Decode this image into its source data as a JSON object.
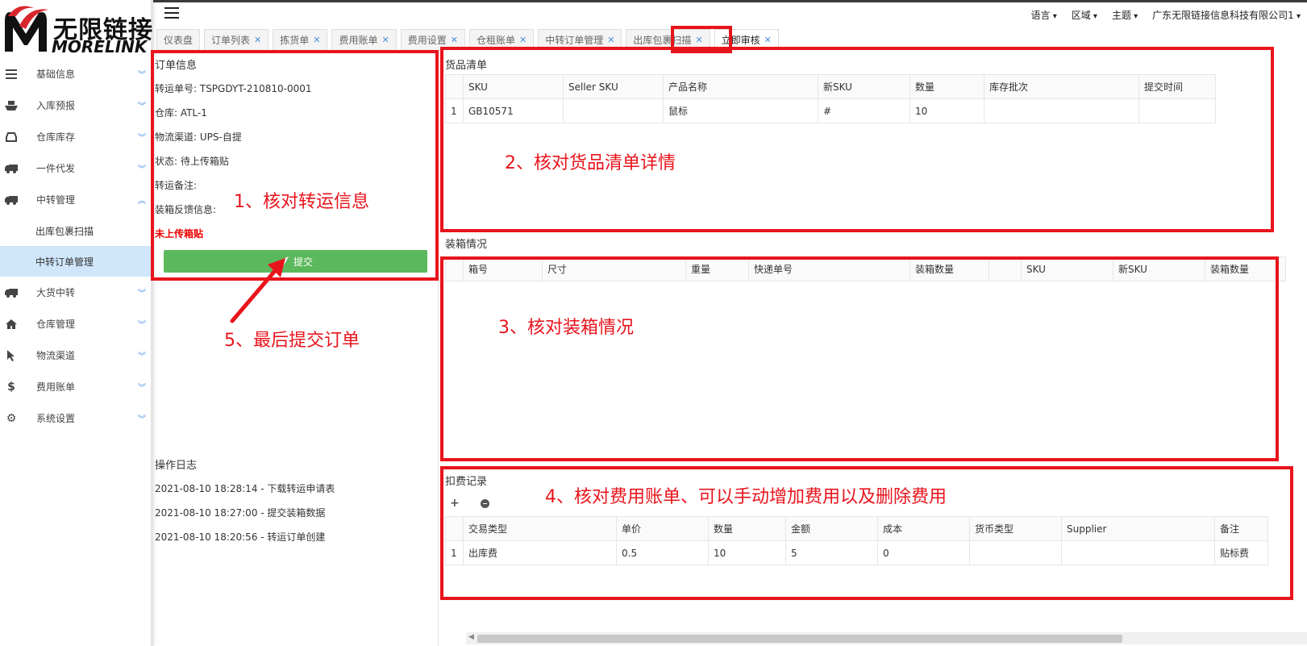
{
  "logo": {
    "cn": "无限链接",
    "en": "MORELINK"
  },
  "header": {
    "menus": [
      "语言",
      "区域",
      "主题",
      "广东无限链接信息科技有限公司1"
    ]
  },
  "sidebar": {
    "items": [
      {
        "label": "基础信息",
        "icon": "menu-icon"
      },
      {
        "label": "入库预报",
        "icon": "ship-icon"
      },
      {
        "label": "仓库库存",
        "icon": "inbox-icon"
      },
      {
        "label": "一件代发",
        "icon": "truck-icon"
      },
      {
        "label": "中转管理",
        "icon": "truck-icon"
      },
      {
        "label": "大货中转",
        "icon": "truck-icon"
      },
      {
        "label": "仓库管理",
        "icon": "home-icon"
      },
      {
        "label": "物流渠道",
        "icon": "cursor-icon"
      },
      {
        "label": "费用账单",
        "icon": "dollar-icon"
      },
      {
        "label": "系统设置",
        "icon": "gear-icon"
      }
    ],
    "subitems": [
      "出库包裹扫描",
      "中转订单管理"
    ]
  },
  "tabs": [
    {
      "label": "仪表盘",
      "closable": false
    },
    {
      "label": "订单列表",
      "closable": true
    },
    {
      "label": "拣货单",
      "closable": true
    },
    {
      "label": "费用账单",
      "closable": true
    },
    {
      "label": "费用设置",
      "closable": true
    },
    {
      "label": "仓租账单",
      "closable": true
    },
    {
      "label": "中转订单管理",
      "closable": true
    },
    {
      "label": "出库包裹扫描",
      "closable": true
    },
    {
      "label": "立即审核",
      "closable": true
    }
  ],
  "order_info": {
    "title": "订单信息",
    "transfer_no": "转运单号: TSPGDYT-210810-0001",
    "warehouse": "仓库: ATL-1",
    "channel": "物流渠道: UPS-自提",
    "status": "状态: 待上传箱贴",
    "remark": "转运备注:",
    "feedback": "装箱反馈信息:",
    "warning": "未上传箱贴",
    "submit_label": "提交"
  },
  "log": {
    "title": "操作日志",
    "entries": [
      "2021-08-10 18:28:14 - 下载转运申请表",
      "2021-08-10 18:27:00 - 提交装箱数据",
      "2021-08-10 18:20:56 - 转运订单创建"
    ]
  },
  "goods": {
    "title": "货品清单",
    "headers": [
      "",
      "SKU",
      "Seller SKU",
      "产品名称",
      "新SKU",
      "数量",
      "库存批次",
      "提交时间"
    ],
    "rows": [
      [
        "1",
        "GB10571",
        "",
        "鼠标",
        "#",
        "10",
        "",
        ""
      ]
    ]
  },
  "packing": {
    "title": "装箱情况",
    "headers": [
      "",
      "箱号",
      "尺寸",
      "重量",
      "快递单号",
      "装箱数量",
      "",
      "SKU",
      "新SKU",
      "装箱数量"
    ]
  },
  "fees": {
    "title": "扣费记录",
    "add_icon": "plus-icon",
    "remove_icon": "minus-circle-icon",
    "headers": [
      "",
      "交易类型",
      "单价",
      "数量",
      "金额",
      "成本",
      "货币类型",
      "Supplier",
      "备注"
    ],
    "rows": [
      [
        "1",
        "出库费",
        "0.5",
        "10",
        "5",
        "0",
        "",
        "",
        "贴标费"
      ]
    ]
  },
  "annotations": {
    "a1": "1、核对转运信息",
    "a2": "2、核对货品清单详情",
    "a3": "3、核对装箱情况",
    "a4": "4、核对费用账单、可以手动增加费用以及删除费用",
    "a5": "5、最后提交订单",
    "color": "#e8141c"
  }
}
